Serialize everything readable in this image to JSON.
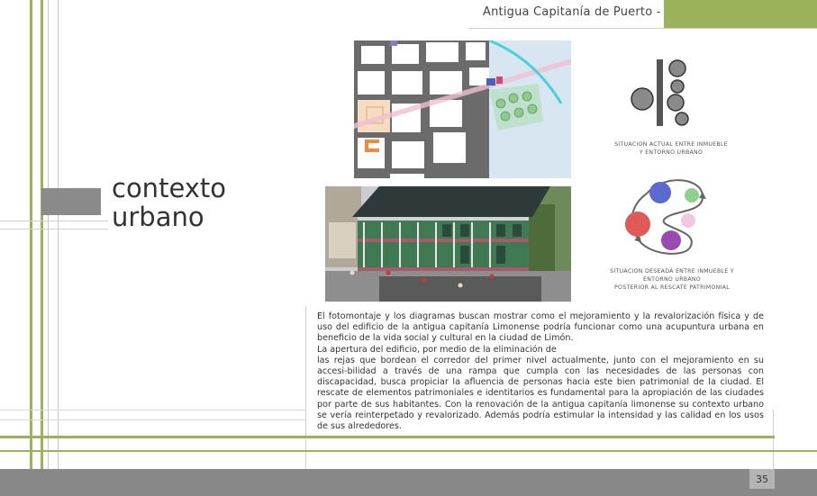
{
  "header": {
    "title": "Antigua Capitanía de Puerto - Limón"
  },
  "section": {
    "title_line1": "contexto",
    "title_line2": "urbano"
  },
  "captions": {
    "current": [
      "SITUACION ACTUAL ENTRE INMUEBLE",
      "Y ENTORNO URBANO"
    ],
    "desired": [
      "SITUACION DESEADA ENTRE INMUEBLE Y",
      "ENTORNO URBANO",
      "POSTERIOR AL RESCATE PATRIMONIAL"
    ]
  },
  "body": {
    "p1": "El fotomontaje y los diagramas buscan mostrar como el mejoramiento y la revalorización física y de uso del edificio de la antigua capitanía Limonense podría funcionar como una acupuntura urbana en beneficio de la vida social y cultural en la ciudad de Limón.",
    "p2": "La apertura del edificio, por medio de la eliminación de",
    "p3": "las rejas que bordean el corredor del primer nivel actualmente, junto con el mejoramiento en su accesi-bilidad a través de una rampa que cumpla con las necesidades de las personas con discapacidad, busca propiciar la afluencia de personas hacia este bien patrimonial de la ciudad. El rescate de elementos patrimoniales e identitarios es fundamental para la apropiación de las ciudades por parte de sus habitantes. Con la renovación de la antigua capitanía limonense su contexto urbano se vería reinterpetado y revalorizado. Además podría estimular la intensidad y las calidad en los usos de sus alrededores."
  },
  "footer": {
    "page_number": "35"
  },
  "colors": {
    "accent_green": "#9ab35a",
    "footer_gray": "#888888",
    "tab_gray": "#8a8a8a"
  }
}
